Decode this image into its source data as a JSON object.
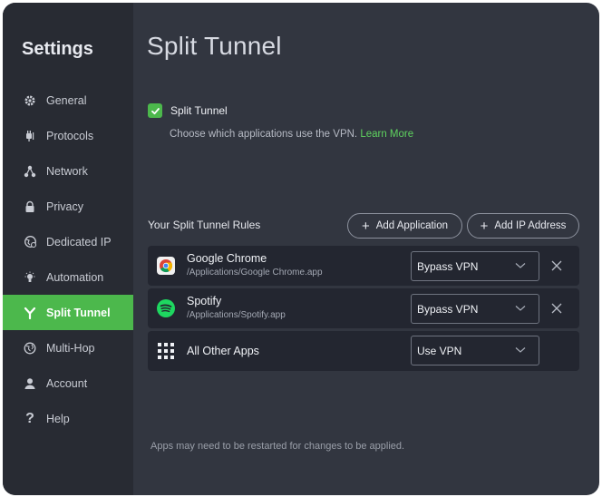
{
  "sidebar": {
    "title": "Settings",
    "items": [
      {
        "label": "General",
        "icon": "gear-icon"
      },
      {
        "label": "Protocols",
        "icon": "plug-icon"
      },
      {
        "label": "Network",
        "icon": "network-icon"
      },
      {
        "label": "Privacy",
        "icon": "lock-icon"
      },
      {
        "label": "Dedicated IP",
        "icon": "dedicated-ip-icon"
      },
      {
        "label": "Automation",
        "icon": "lightbulb-icon"
      },
      {
        "label": "Split Tunnel",
        "icon": "split-icon",
        "active": true
      },
      {
        "label": "Multi-Hop",
        "icon": "globe-icon"
      },
      {
        "label": "Account",
        "icon": "user-icon"
      },
      {
        "label": "Help",
        "icon": "question-icon"
      }
    ]
  },
  "main": {
    "title": "Split Tunnel",
    "split_tunnel_toggle": {
      "label": "Split Tunnel",
      "checked": true
    },
    "description": "Choose which applications use the VPN.",
    "learn_more": "Learn More",
    "rules_title": "Your Split Tunnel Rules",
    "add_application": "Add Application",
    "add_ip_address": "Add IP Address",
    "rules": [
      {
        "name": "Google Chrome",
        "path": "/Applications/Google Chrome.app",
        "mode": "Bypass VPN",
        "icon": "chrome-icon"
      },
      {
        "name": "Spotify",
        "path": "/Applications/Spotify.app",
        "mode": "Bypass VPN",
        "icon": "spotify-icon"
      },
      {
        "name": "All Other Apps",
        "path": "",
        "mode": "Use VPN",
        "icon": "grid-icon"
      }
    ],
    "footer_note": "Apps may need to be restarted for changes to be applied."
  },
  "colors": {
    "accent": "#4cb84c",
    "sidebar_bg": "#282b33",
    "main_bg": "#323640",
    "row_bg": "#232630"
  }
}
